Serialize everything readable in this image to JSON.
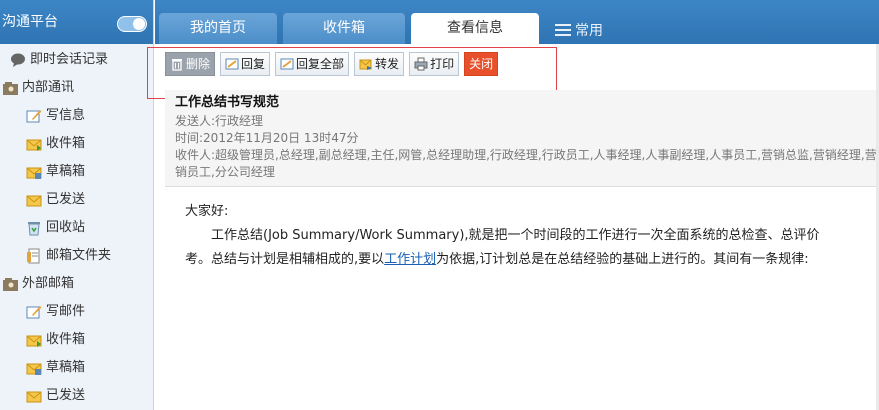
{
  "sidebar": {
    "title": "沟通平台",
    "items": [
      {
        "label": "即时会话记录",
        "icon": "chat-bubble-icon"
      },
      {
        "label": "内部通讯",
        "icon": "folder-contacts-icon"
      },
      {
        "label": "写信息",
        "icon": "compose-icon"
      },
      {
        "label": "收件箱",
        "icon": "inbox-icon"
      },
      {
        "label": "草稿箱",
        "icon": "drafts-icon"
      },
      {
        "label": "已发送",
        "icon": "sent-icon"
      },
      {
        "label": "回收站",
        "icon": "recycle-bin-icon"
      },
      {
        "label": "邮箱文件夹",
        "icon": "mail-folder-icon"
      },
      {
        "label": "外部邮箱",
        "icon": "folder-contacts-icon"
      },
      {
        "label": "写邮件",
        "icon": "compose-icon"
      },
      {
        "label": "收件箱",
        "icon": "inbox-icon"
      },
      {
        "label": "草稿箱",
        "icon": "drafts-icon"
      },
      {
        "label": "已发送",
        "icon": "sent-icon"
      }
    ]
  },
  "tabs": [
    {
      "label": "我的首页"
    },
    {
      "label": "收件箱"
    },
    {
      "label": "查看信息"
    }
  ],
  "tab_extra": "常用",
  "toolbar": {
    "delete": "删除",
    "reply": "回复",
    "reply_all": "回复全部",
    "forward": "转发",
    "print": "打印",
    "close": "关闭"
  },
  "mail": {
    "subject": "工作总结书写规范",
    "sender": "发送人:行政经理",
    "time": "时间:2012年11月20日 13时47分",
    "recipients": "收件人:超级管理员,总经理,副总经理,主任,网管,总经理助理,行政经理,行政员工,人事经理,人事副经理,人事员工,营销总监,营销经理,营销员工,分公司经理"
  },
  "body": {
    "greeting": "大家好:",
    "line1": "工作总结(Job Summary/Work Summary),就是把一个时间段的工作进行一次全面系统的总检查、总评价",
    "line2_pre": "考。总结与计划是相辅相成的,要以",
    "line2_link": "工作计划",
    "line2_post": "为依据,订计划总是在总结经验的基础上进行的。其间有一条规律:"
  },
  "colors": {
    "header_blue": "#3d86c6",
    "close_red": "#e8502c",
    "highlight_red": "#e0444a"
  }
}
